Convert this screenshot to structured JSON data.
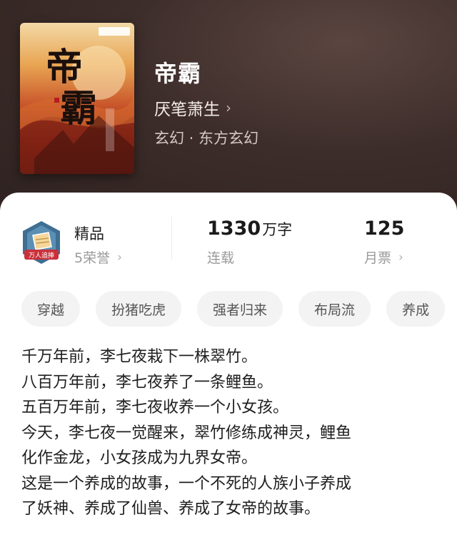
{
  "book": {
    "title": "帝霸",
    "author": "厌笔萧生",
    "genre": "玄幻 · 东方玄幻",
    "cover_title_text": "帝霸"
  },
  "icons": {
    "author_chevron": "chevron-right-icon",
    "honor_chevron": "chevron-right-icon",
    "ticket_chevron": "chevron-right-icon",
    "badge": "quality-badge-icon"
  },
  "stats": {
    "quality_label": "精品",
    "honor": "5荣誉",
    "word_count": "1330",
    "word_unit": "万字",
    "status": "连载",
    "monthly_tickets": "125",
    "monthly_tickets_label": "月票",
    "badge_text": "万人追捧"
  },
  "tags": [
    "穿越",
    "扮猪吃虎",
    "强者归来",
    "布局流",
    "养成"
  ],
  "description": [
    "千万年前，李七夜栽下一株翠竹。",
    "八百万年前，李七夜养了一条鲤鱼。",
    "五百万年前，李七夜收养一个小女孩。",
    "今天，李七夜一觉醒来，翠竹修练成神灵，鲤鱼",
    "化作金龙，小女孩成为九界女帝。",
    "这是一个养成的故事，一个不死的人族小子养成",
    "了妖神、养成了仙兽、养成了女帝的故事。"
  ],
  "colors": {
    "hero_bg": "#3d2d2a",
    "panel_bg": "#ffffff",
    "tag_bg": "#f3f3f3",
    "badge_blue": "#3f6e93",
    "badge_red": "#c9303a"
  }
}
